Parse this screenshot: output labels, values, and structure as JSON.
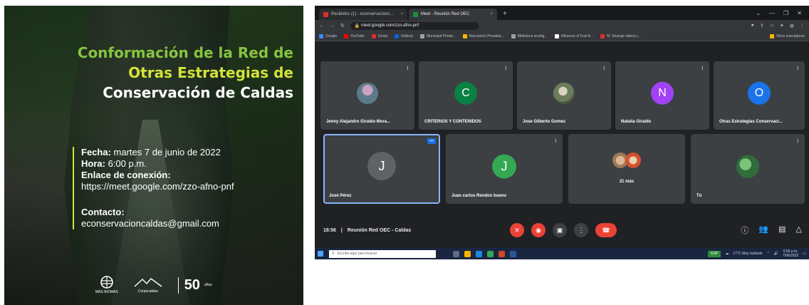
{
  "poster": {
    "title_line1": "Conformación de la Red de",
    "title_line2": "Otras Estrategias de",
    "title_line3": "Conservación de Caldas",
    "fecha_label": "Fecha:",
    "fecha_value": " martes 7 de junio de 2022",
    "hora_label": "Hora:",
    "hora_value": " 6:00 p.m.",
    "enlace_label": "Enlace de conexión:",
    "enlace_value": "https://meet.google.com/zzo-afno-pnf",
    "contacto_label": "Contacto:",
    "contacto_value": "econservacioncaldas@gmail.com",
    "logo1_text": "MÁS BIOMAS",
    "logo2_text": "Corpocaldas",
    "logo3_number": "50",
    "logo3_text": "años",
    "colors": {
      "green": "#86c440",
      "yellow": "#d4e23a"
    }
  },
  "browser": {
    "tabs": [
      {
        "label": "Recibidos (1) - econservacionc...",
        "favicon_color": "#d93025"
      },
      {
        "label": "Meet - Reunión Red OEC",
        "favicon_color": "#1e8e3e"
      }
    ],
    "new_tab": "+",
    "url": "meet.google.com/zzo-afno-pnf",
    "bookmarks": [
      {
        "label": "Google",
        "color": "#4285f4"
      },
      {
        "label": "YouTube",
        "color": "#ff0000"
      },
      {
        "label": "Gmail",
        "color": "#d93025"
      },
      {
        "label": "Outlook",
        "color": "#0a64d6"
      },
      {
        "label": "Municipal Privati...",
        "color": "#9aa0a6"
      },
      {
        "label": "Asociación Privatizá...",
        "color": "#f4b400"
      },
      {
        "label": "Biblioteca ecológ...",
        "color": "#9aa0a6"
      },
      {
        "label": "Influence of Fuel A...",
        "color": "#ffffff"
      },
      {
        "label": "M. Strange videos j...",
        "color": "#d93025"
      }
    ],
    "bookmarks_right": "Otros marcadores"
  },
  "meet": {
    "participants_row1": [
      {
        "name": "Jenny Alejandro Giraldo Mora...",
        "initial": "",
        "avatar_color": "#7a9bbf",
        "photo": true
      },
      {
        "name": "CRITERIOS Y CONTENIDOS",
        "initial": "C",
        "avatar_color": "#0b8043",
        "photo": false
      },
      {
        "name": "Jose Gilberto Gomez",
        "initial": "",
        "avatar_color": "#8a7d6a",
        "photo": true
      },
      {
        "name": "Natalia Giraldo",
        "initial": "N",
        "avatar_color": "#a142f4",
        "photo": false
      },
      {
        "name": "Otras Estrategias Conservaci...",
        "initial": "O",
        "avatar_color": "#1a73e8",
        "photo": false
      }
    ],
    "participants_row2": [
      {
        "name": "José Pérez",
        "initial": "J",
        "avatar_color": "#5f6368",
        "photo": false,
        "selected": true
      },
      {
        "name": "Juan carlos Rendon bueno",
        "initial": "J",
        "avatar_color": "#34a853",
        "photo": false
      },
      {
        "name": "21 más",
        "initial": "",
        "avatar_color": "#c9a97a",
        "photo": true
      },
      {
        "name": "Tú",
        "initial": "",
        "avatar_color": "#3f8f4a",
        "photo": true
      }
    ],
    "meeting_time": "18:56",
    "meeting_sep": "|",
    "meeting_name": "Reunión Red OEC - Caldas",
    "controls": [
      {
        "icon": "mic-off-icon",
        "glyph": "✕",
        "color": "red"
      },
      {
        "icon": "camera-off-icon",
        "glyph": "◉",
        "color": "red"
      },
      {
        "icon": "present-icon",
        "glyph": "▣",
        "color": "grey"
      },
      {
        "icon": "more-icon",
        "glyph": "⋮",
        "color": "grey"
      },
      {
        "icon": "hangup-icon",
        "glyph": "☎",
        "color": "end"
      }
    ],
    "right_controls": [
      {
        "icon": "info-icon",
        "glyph": "ⓘ"
      },
      {
        "icon": "people-icon",
        "glyph": "👥"
      },
      {
        "icon": "chat-icon",
        "glyph": "▤"
      },
      {
        "icon": "activities-icon",
        "glyph": "△"
      }
    ]
  },
  "taskbar": {
    "search_placeholder": "Escribe aquí para buscar",
    "tray_badge": "ESP",
    "weather": "17°C Muy nublado",
    "clock_time": "6:56 p.m.",
    "clock_date": "7/06/2022"
  }
}
